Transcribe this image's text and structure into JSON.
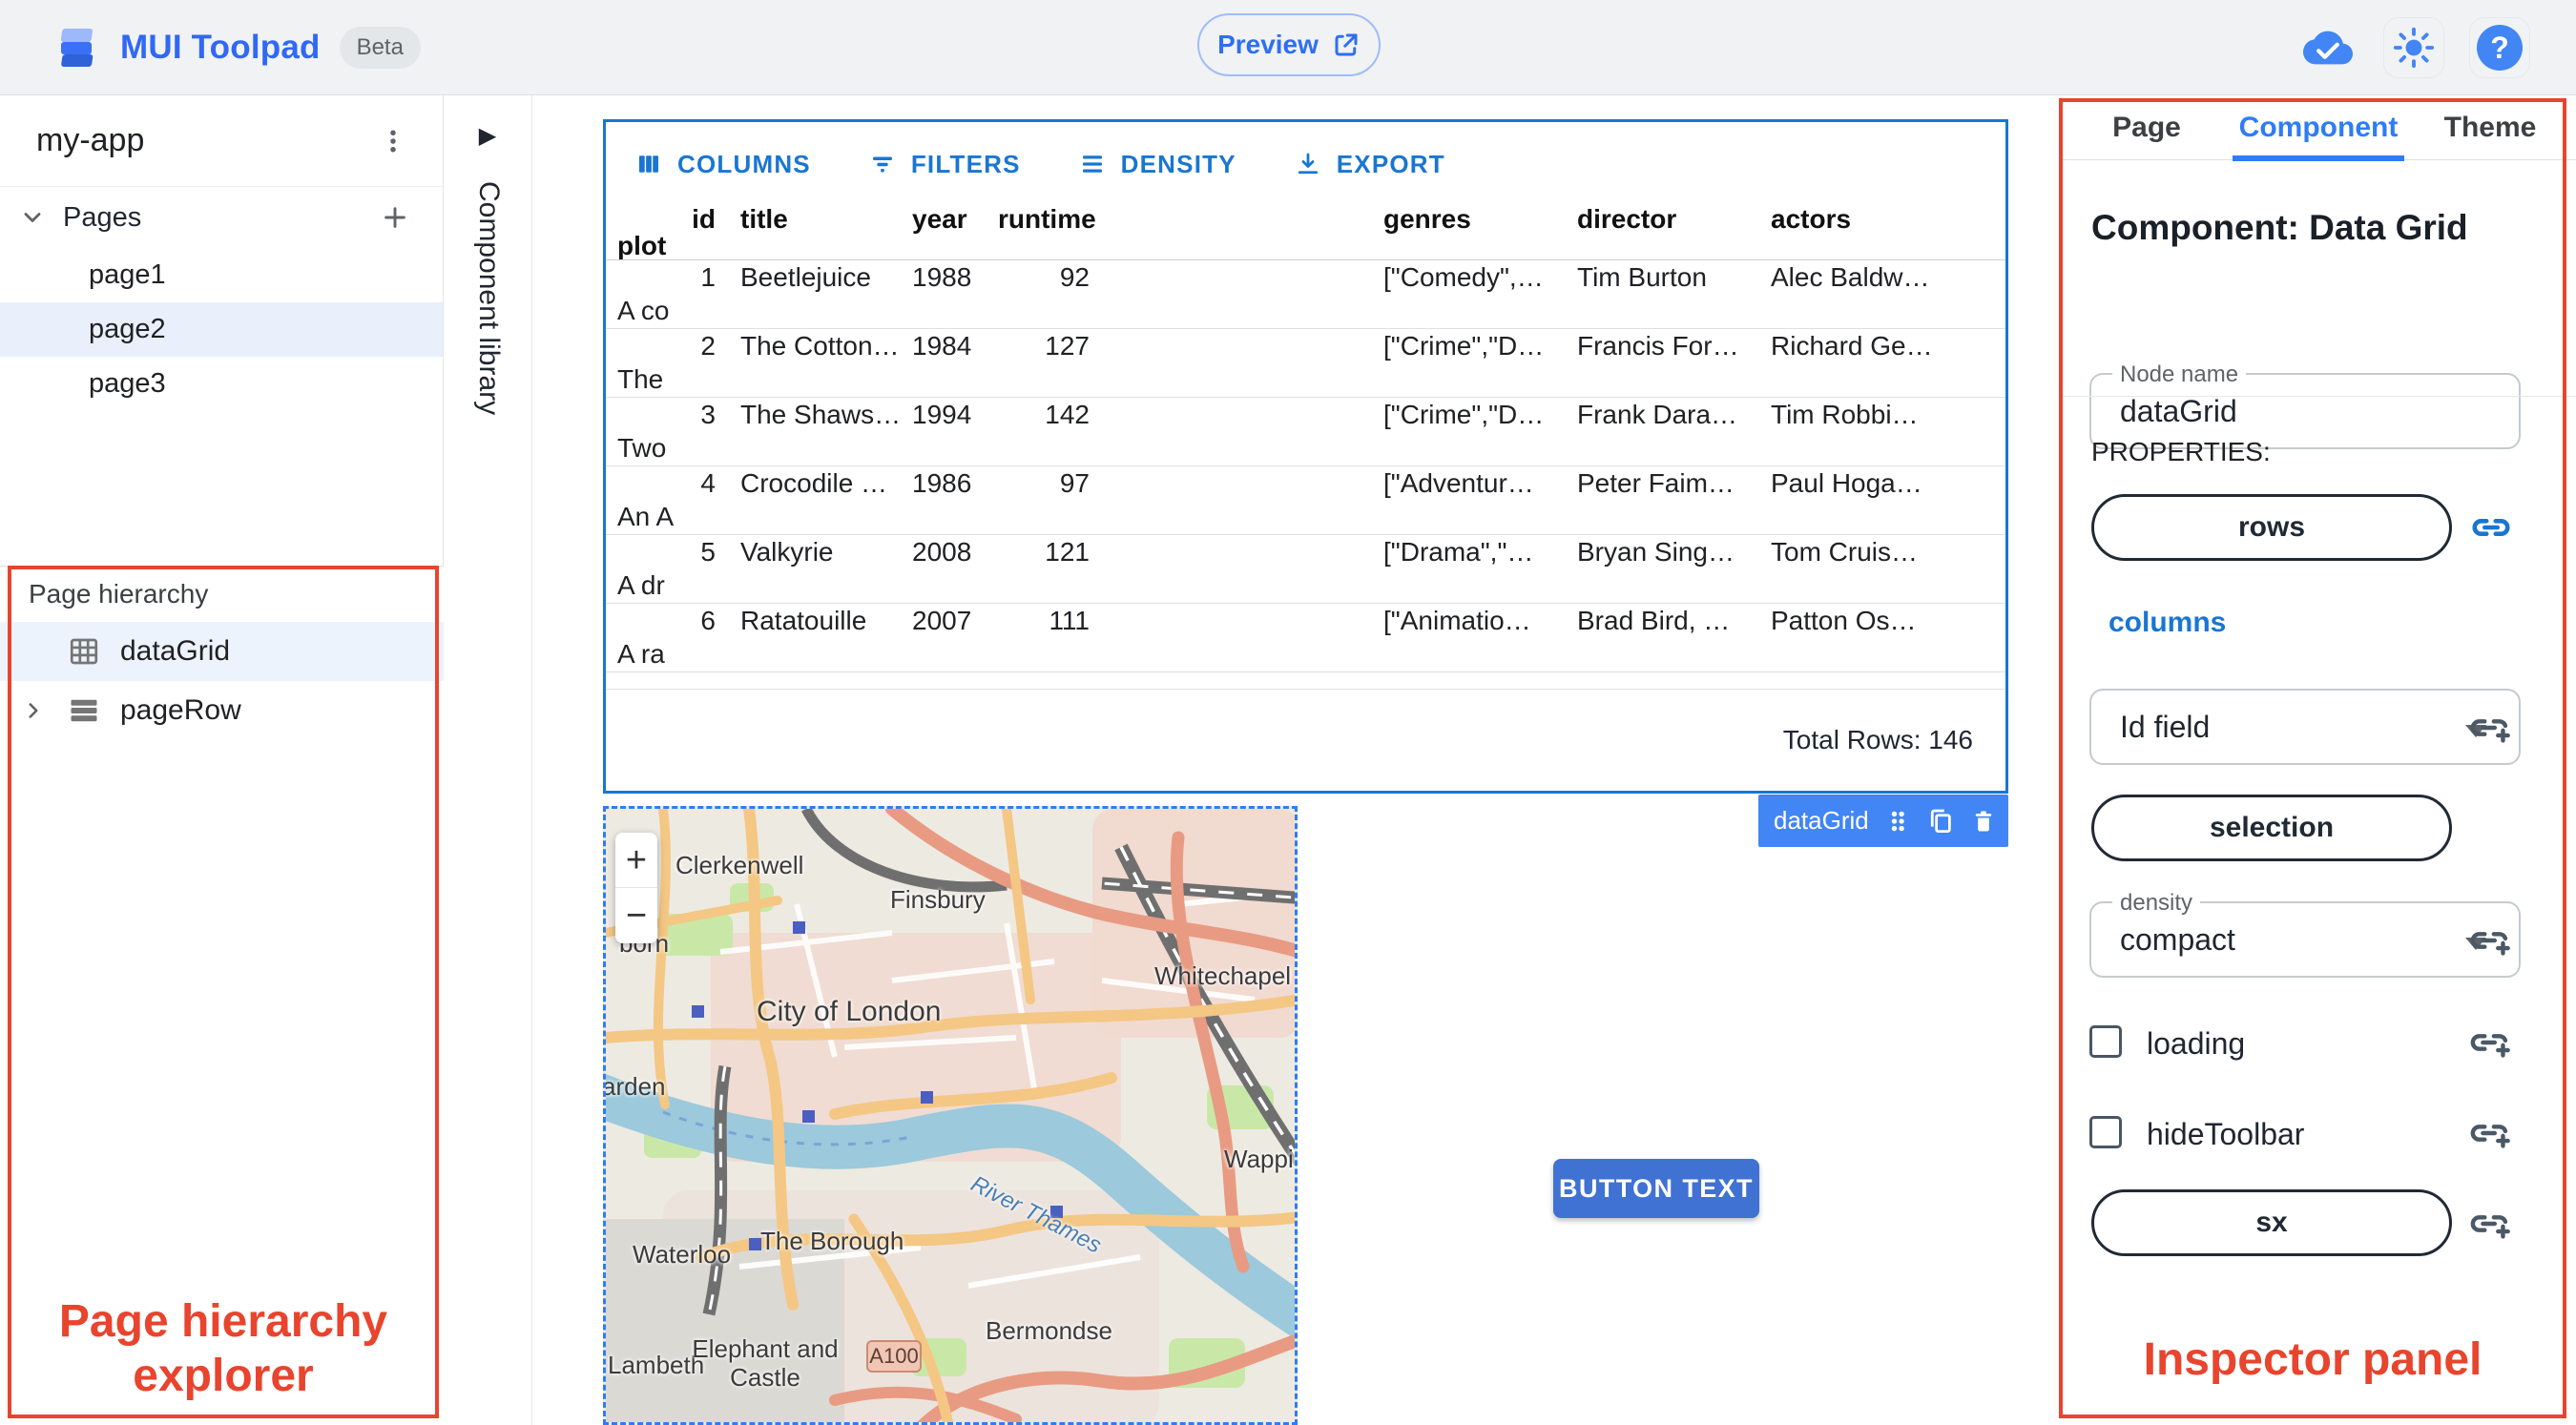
{
  "header": {
    "app_title": "MUI Toolpad",
    "beta_badge": "Beta",
    "preview_label": "Preview"
  },
  "icons": [
    "toolpad-logo",
    "open-in-new",
    "cloud-done",
    "brightness",
    "help",
    "kebab-menu",
    "chevron-down",
    "plus",
    "collapse-arrow",
    "grid",
    "rows",
    "chevron-right",
    "columns",
    "filter",
    "density",
    "export",
    "drag-handle",
    "copy",
    "trash",
    "link",
    "add-link",
    "checkbox"
  ],
  "sidebar": {
    "project_name": "my-app",
    "pages_label": "Pages",
    "pages": [
      {
        "label": "page1"
      },
      {
        "label": "page2"
      },
      {
        "label": "page3"
      }
    ],
    "active_page": "page2"
  },
  "library": {
    "label": "Component library"
  },
  "hierarchy": {
    "title": "Page hierarchy",
    "items": [
      {
        "label": "dataGrid",
        "icon": "grid",
        "selected": true
      },
      {
        "label": "pageRow",
        "icon": "rows",
        "selected": false
      }
    ]
  },
  "grid": {
    "toolbar": [
      {
        "label": "COLUMNS"
      },
      {
        "label": "FILTERS"
      },
      {
        "label": "DENSITY"
      },
      {
        "label": "EXPORT"
      }
    ],
    "columns": [
      "id",
      "title",
      "year",
      "runtime",
      "genres",
      "director",
      "actors",
      "plot"
    ],
    "rows": [
      {
        "id": "1",
        "title": "Beetlejuice",
        "year": "1988",
        "runtime": "92",
        "genres": "[\"Comedy\",…",
        "director": "Tim Burton",
        "actors": "Alec Baldw…",
        "plot": "A co"
      },
      {
        "id": "2",
        "title": "The Cotton…",
        "year": "1984",
        "runtime": "127",
        "genres": "[\"Crime\",\"D…",
        "director": "Francis For…",
        "actors": "Richard Ge…",
        "plot": "The"
      },
      {
        "id": "3",
        "title": "The Shaws…",
        "year": "1994",
        "runtime": "142",
        "genres": "[\"Crime\",\"D…",
        "director": "Frank Dara…",
        "actors": "Tim Robbi…",
        "plot": "Two"
      },
      {
        "id": "4",
        "title": "Crocodile …",
        "year": "1986",
        "runtime": "97",
        "genres": "[\"Adventur…",
        "director": "Peter Faim…",
        "actors": "Paul Hoga…",
        "plot": "An A"
      },
      {
        "id": "5",
        "title": "Valkyrie",
        "year": "2008",
        "runtime": "121",
        "genres": "[\"Drama\",\"…",
        "director": "Bryan Sing…",
        "actors": "Tom Cruis…",
        "plot": "A dr"
      },
      {
        "id": "6",
        "title": "Ratatouille",
        "year": "2007",
        "runtime": "111",
        "genres": "[\"Animatio…",
        "director": "Brad Bird, …",
        "actors": "Patton Os…",
        "plot": "A ra"
      }
    ],
    "footer_total": "Total Rows: 146",
    "chip_label": "dataGrid"
  },
  "map": {
    "zoom_in": "+",
    "zoom_out": "−",
    "labels": [
      {
        "text": "Clerkenwell"
      },
      {
        "text": "Finsbury"
      },
      {
        "text": "Whitechapel"
      },
      {
        "text": "City of London"
      },
      {
        "text": "born"
      },
      {
        "text": "arden"
      },
      {
        "text": "Wapping"
      },
      {
        "text": "Waterloo"
      },
      {
        "text": "The Borough"
      },
      {
        "text": "Lambeth"
      },
      {
        "text": "Elephant and Castle"
      },
      {
        "text": "Bermondse"
      },
      {
        "text": "River Thames"
      }
    ],
    "road_badge": "A100"
  },
  "canvas_button": {
    "label": "BUTTON TEXT"
  },
  "inspector": {
    "tabs": [
      {
        "label": "Page"
      },
      {
        "label": "Component"
      },
      {
        "label": "Theme"
      }
    ],
    "active_tab": "Component",
    "heading": "Component: Data Grid",
    "node_name": {
      "label": "Node name",
      "value": "dataGrid"
    },
    "properties_label": "PROPERTIES:",
    "rows_button": "rows",
    "columns_link": "columns",
    "id_field": {
      "value": "Id field"
    },
    "selection_button": "selection",
    "density": {
      "label": "density",
      "value": "compact"
    },
    "loading_label": "loading",
    "loading_checked": false,
    "hide_toolbar_label": "hideToolbar",
    "hide_toolbar_checked": false,
    "sx_button": "sx"
  },
  "annotations": {
    "hierarchy": "Page hierarchy explorer",
    "inspector": "Inspector panel"
  },
  "colors": {
    "primary": "#1976d2",
    "brand_blue": "#3068f6",
    "tab_active_blue": "#2e7cf6",
    "chip_blue": "#4285f4",
    "canvas_button_blue": "#3f72d2",
    "annotation_red": "#e8442e",
    "selected_row_bg": "#e9f0fc",
    "topbar_bg": "#f1f2f4"
  }
}
